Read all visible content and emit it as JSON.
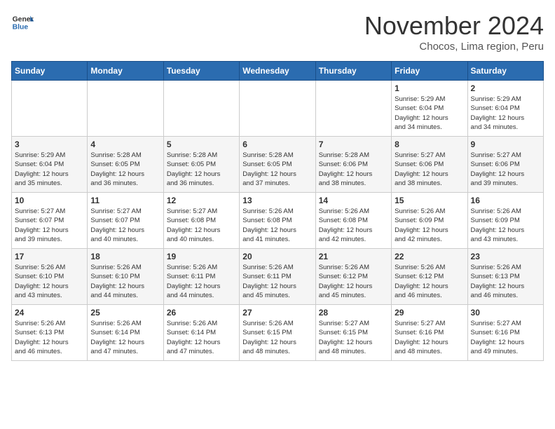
{
  "header": {
    "logo_general": "General",
    "logo_blue": "Blue",
    "month_title": "November 2024",
    "subtitle": "Chocos, Lima region, Peru"
  },
  "days_of_week": [
    "Sunday",
    "Monday",
    "Tuesday",
    "Wednesday",
    "Thursday",
    "Friday",
    "Saturday"
  ],
  "weeks": [
    {
      "days": [
        {
          "num": "",
          "info": ""
        },
        {
          "num": "",
          "info": ""
        },
        {
          "num": "",
          "info": ""
        },
        {
          "num": "",
          "info": ""
        },
        {
          "num": "",
          "info": ""
        },
        {
          "num": "1",
          "info": "Sunrise: 5:29 AM\nSunset: 6:04 PM\nDaylight: 12 hours\nand 34 minutes."
        },
        {
          "num": "2",
          "info": "Sunrise: 5:29 AM\nSunset: 6:04 PM\nDaylight: 12 hours\nand 34 minutes."
        }
      ]
    },
    {
      "days": [
        {
          "num": "3",
          "info": "Sunrise: 5:29 AM\nSunset: 6:04 PM\nDaylight: 12 hours\nand 35 minutes."
        },
        {
          "num": "4",
          "info": "Sunrise: 5:28 AM\nSunset: 6:05 PM\nDaylight: 12 hours\nand 36 minutes."
        },
        {
          "num": "5",
          "info": "Sunrise: 5:28 AM\nSunset: 6:05 PM\nDaylight: 12 hours\nand 36 minutes."
        },
        {
          "num": "6",
          "info": "Sunrise: 5:28 AM\nSunset: 6:05 PM\nDaylight: 12 hours\nand 37 minutes."
        },
        {
          "num": "7",
          "info": "Sunrise: 5:28 AM\nSunset: 6:06 PM\nDaylight: 12 hours\nand 38 minutes."
        },
        {
          "num": "8",
          "info": "Sunrise: 5:27 AM\nSunset: 6:06 PM\nDaylight: 12 hours\nand 38 minutes."
        },
        {
          "num": "9",
          "info": "Sunrise: 5:27 AM\nSunset: 6:06 PM\nDaylight: 12 hours\nand 39 minutes."
        }
      ]
    },
    {
      "days": [
        {
          "num": "10",
          "info": "Sunrise: 5:27 AM\nSunset: 6:07 PM\nDaylight: 12 hours\nand 39 minutes."
        },
        {
          "num": "11",
          "info": "Sunrise: 5:27 AM\nSunset: 6:07 PM\nDaylight: 12 hours\nand 40 minutes."
        },
        {
          "num": "12",
          "info": "Sunrise: 5:27 AM\nSunset: 6:08 PM\nDaylight: 12 hours\nand 40 minutes."
        },
        {
          "num": "13",
          "info": "Sunrise: 5:26 AM\nSunset: 6:08 PM\nDaylight: 12 hours\nand 41 minutes."
        },
        {
          "num": "14",
          "info": "Sunrise: 5:26 AM\nSunset: 6:08 PM\nDaylight: 12 hours\nand 42 minutes."
        },
        {
          "num": "15",
          "info": "Sunrise: 5:26 AM\nSunset: 6:09 PM\nDaylight: 12 hours\nand 42 minutes."
        },
        {
          "num": "16",
          "info": "Sunrise: 5:26 AM\nSunset: 6:09 PM\nDaylight: 12 hours\nand 43 minutes."
        }
      ]
    },
    {
      "days": [
        {
          "num": "17",
          "info": "Sunrise: 5:26 AM\nSunset: 6:10 PM\nDaylight: 12 hours\nand 43 minutes."
        },
        {
          "num": "18",
          "info": "Sunrise: 5:26 AM\nSunset: 6:10 PM\nDaylight: 12 hours\nand 44 minutes."
        },
        {
          "num": "19",
          "info": "Sunrise: 5:26 AM\nSunset: 6:11 PM\nDaylight: 12 hours\nand 44 minutes."
        },
        {
          "num": "20",
          "info": "Sunrise: 5:26 AM\nSunset: 6:11 PM\nDaylight: 12 hours\nand 45 minutes."
        },
        {
          "num": "21",
          "info": "Sunrise: 5:26 AM\nSunset: 6:12 PM\nDaylight: 12 hours\nand 45 minutes."
        },
        {
          "num": "22",
          "info": "Sunrise: 5:26 AM\nSunset: 6:12 PM\nDaylight: 12 hours\nand 46 minutes."
        },
        {
          "num": "23",
          "info": "Sunrise: 5:26 AM\nSunset: 6:13 PM\nDaylight: 12 hours\nand 46 minutes."
        }
      ]
    },
    {
      "days": [
        {
          "num": "24",
          "info": "Sunrise: 5:26 AM\nSunset: 6:13 PM\nDaylight: 12 hours\nand 46 minutes."
        },
        {
          "num": "25",
          "info": "Sunrise: 5:26 AM\nSunset: 6:14 PM\nDaylight: 12 hours\nand 47 minutes."
        },
        {
          "num": "26",
          "info": "Sunrise: 5:26 AM\nSunset: 6:14 PM\nDaylight: 12 hours\nand 47 minutes."
        },
        {
          "num": "27",
          "info": "Sunrise: 5:26 AM\nSunset: 6:15 PM\nDaylight: 12 hours\nand 48 minutes."
        },
        {
          "num": "28",
          "info": "Sunrise: 5:27 AM\nSunset: 6:15 PM\nDaylight: 12 hours\nand 48 minutes."
        },
        {
          "num": "29",
          "info": "Sunrise: 5:27 AM\nSunset: 6:16 PM\nDaylight: 12 hours\nand 48 minutes."
        },
        {
          "num": "30",
          "info": "Sunrise: 5:27 AM\nSunset: 6:16 PM\nDaylight: 12 hours\nand 49 minutes."
        }
      ]
    }
  ]
}
